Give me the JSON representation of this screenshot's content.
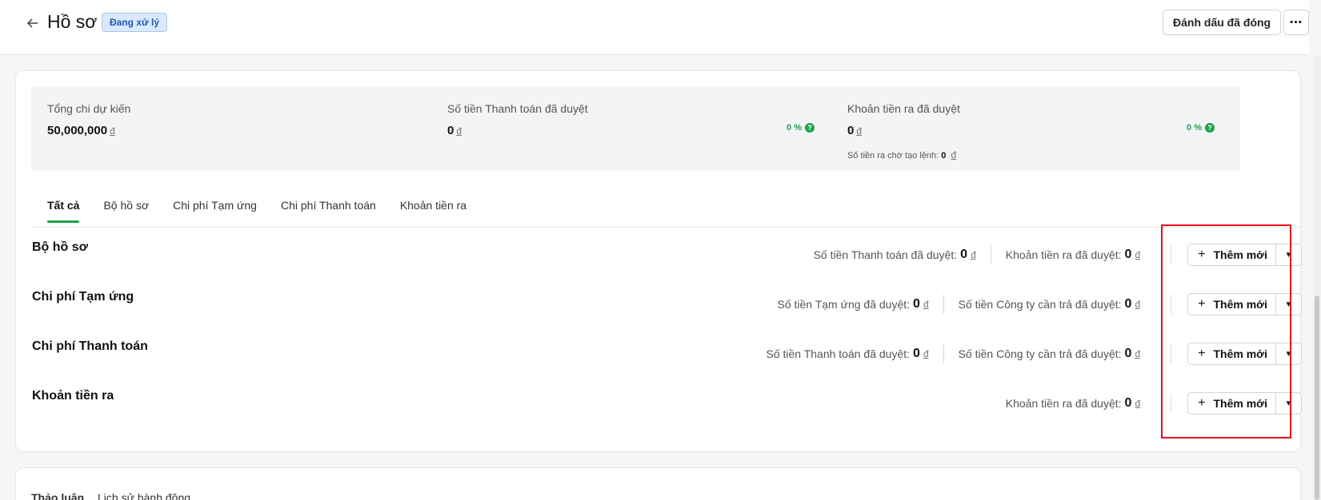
{
  "header": {
    "title": "Hồ sơ",
    "status_badge": "Đang xử lý",
    "mark_closed_label": "Đánh dấu đã đóng",
    "more_label": "⋯"
  },
  "summary": [
    {
      "label": "Tổng chi dự kiến",
      "value": "50,000,000",
      "currency": "đ"
    },
    {
      "label": "Số tiền Thanh toán đã duyệt",
      "value": "0",
      "currency": "đ",
      "percent": "0 %"
    },
    {
      "label": "Khoản tiền ra đã duyệt",
      "value": "0",
      "currency": "đ",
      "percent": "0 %",
      "sub_label": "Số tiền ra chờ tạo lệnh:",
      "sub_value": "0",
      "sub_currency": "đ"
    }
  ],
  "tabs": [
    "Tất cả",
    "Bộ hồ sơ",
    "Chi phí Tạm ứng",
    "Chi phí Thanh toán",
    "Khoản tiền ra"
  ],
  "active_tab": "Tất cả",
  "sections": [
    {
      "title": "Bộ hồ sơ",
      "metrics": [
        {
          "label": "Số tiền Thanh toán đã duyệt:",
          "value": "0",
          "currency": "đ"
        },
        {
          "label": "Khoản tiền ra đã duyệt:",
          "value": "0",
          "currency": "đ"
        }
      ],
      "add_label": "Thêm mới"
    },
    {
      "title": "Chi phí Tạm ứng",
      "metrics": [
        {
          "label": "Số tiền Tạm ứng đã duyệt:",
          "value": "0",
          "currency": "đ"
        },
        {
          "label": "Số tiền Công ty cần trả đã duyệt:",
          "value": "0",
          "currency": "đ"
        }
      ],
      "add_label": "Thêm mới"
    },
    {
      "title": "Chi phí Thanh toán",
      "metrics": [
        {
          "label": "Số tiền Thanh toán đã duyệt:",
          "value": "0",
          "currency": "đ"
        },
        {
          "label": "Số tiền Công ty cần trả đã duyệt:",
          "value": "0",
          "currency": "đ"
        }
      ],
      "add_label": "Thêm mới"
    },
    {
      "title": "Khoản tiền ra",
      "metrics": [
        {
          "label": "Khoản tiền ra đã duyệt:",
          "value": "0",
          "currency": "đ"
        }
      ],
      "add_label": "Thêm mới"
    }
  ],
  "bottom_tabs": [
    "Thảo luận",
    "Lịch sử hành động"
  ],
  "colors": {
    "accent_green": "#1aa34a",
    "highlight_red": "#e8101d",
    "badge_blue": "#1f57b8"
  }
}
